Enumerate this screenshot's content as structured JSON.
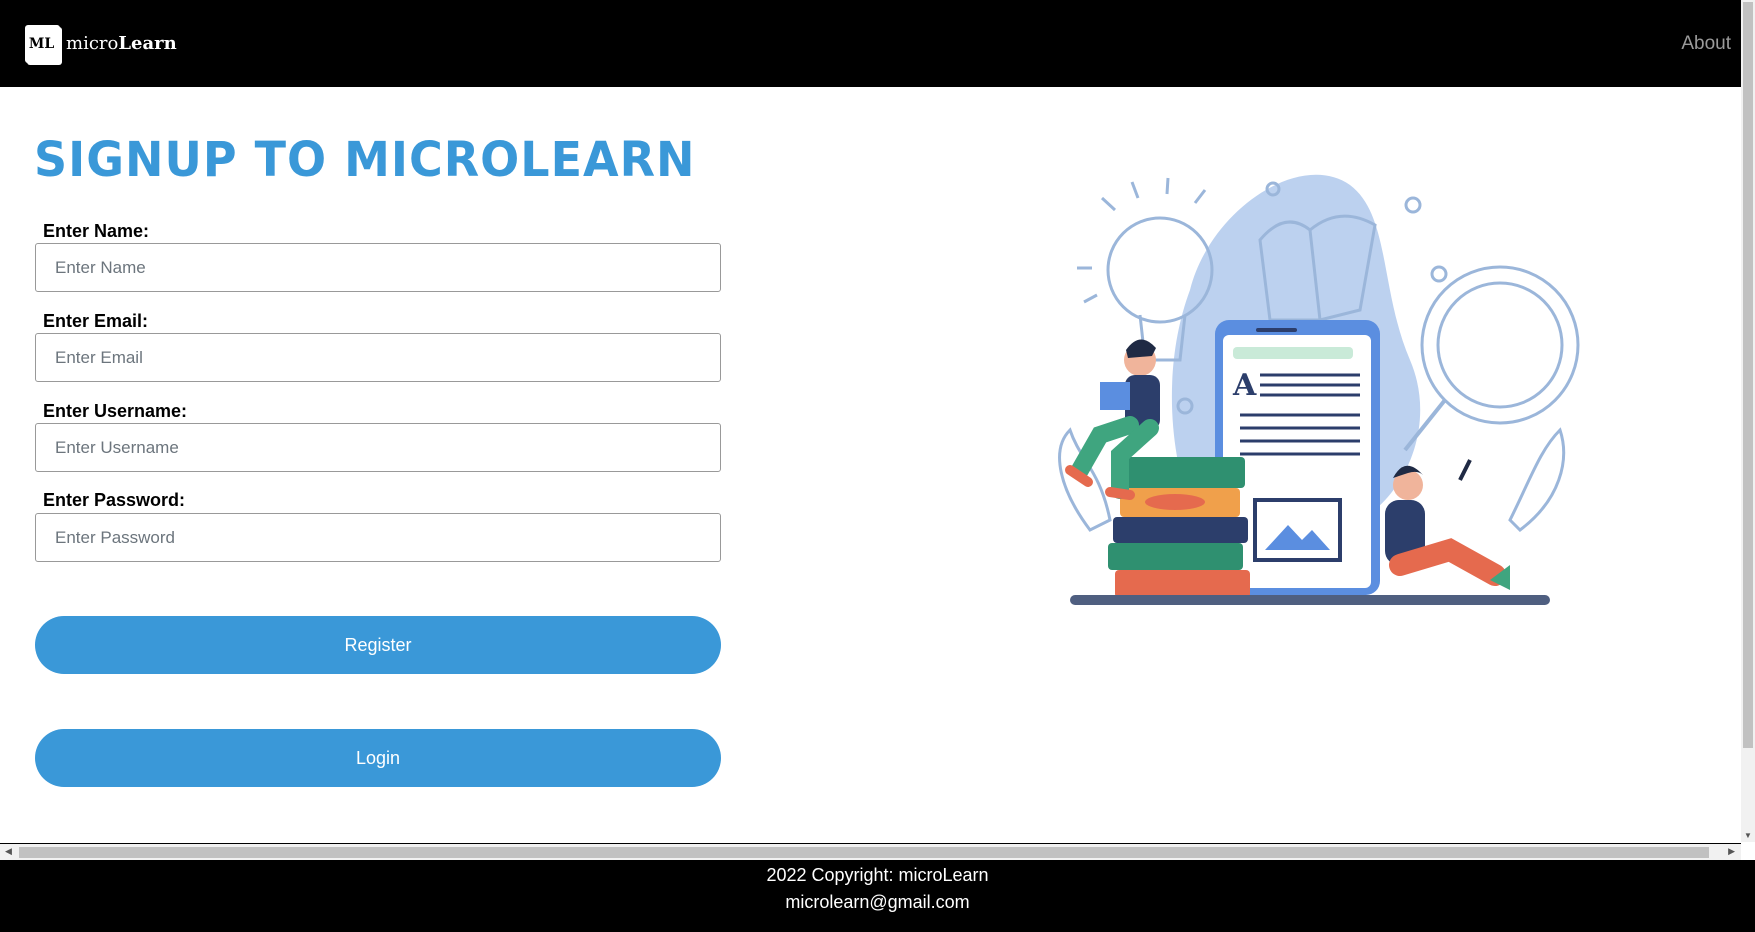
{
  "navbar": {
    "logo_text": "ML",
    "brand_prefix": "micro",
    "brand_suffix": "Learn",
    "about_link": "About"
  },
  "main": {
    "title": "SIGNUP TO MICROLEARN",
    "fields": [
      {
        "label": "Enter Name:",
        "placeholder": "Enter Name",
        "value": ""
      },
      {
        "label": "Enter Email:",
        "placeholder": "Enter Email",
        "value": ""
      },
      {
        "label": "Enter Username:",
        "placeholder": "Enter Username",
        "value": ""
      },
      {
        "label": "Enter Password:",
        "placeholder": "Enter Password",
        "value": ""
      }
    ],
    "register_button": "Register",
    "login_button": "Login"
  },
  "footer": {
    "copyright": "2022 Copyright: microLearn",
    "email": "microlearn@gmail.com"
  },
  "colors": {
    "accent": "#3a98d8",
    "navbar_bg": "#000000",
    "footer_bg": "#000000"
  },
  "illustration": {
    "icon": "online-learning-illustration"
  }
}
